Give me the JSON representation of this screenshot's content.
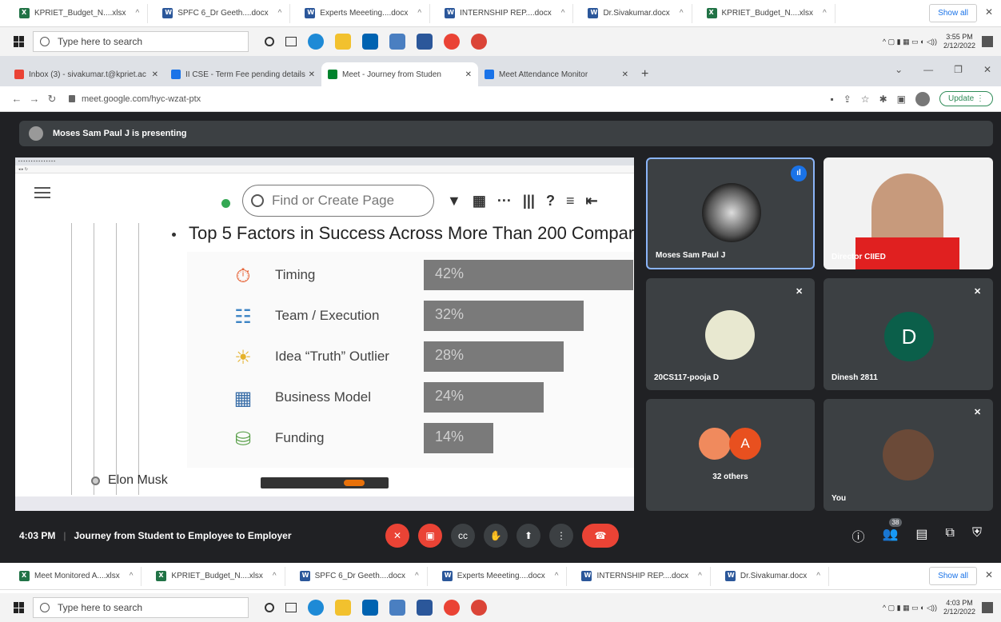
{
  "top_downloads": [
    {
      "name": "KPRIET_Budget_N....xlsx",
      "type": "xls"
    },
    {
      "name": "SPFC 6_Dr Geeth....docx",
      "type": "doc"
    },
    {
      "name": "Experts Meeeting....docx",
      "type": "doc"
    },
    {
      "name": "INTERNSHIP REP....docx",
      "type": "doc"
    },
    {
      "name": "Dr.Sivakumar.docx",
      "type": "doc"
    },
    {
      "name": "KPRIET_Budget_N....xlsx",
      "type": "xls"
    }
  ],
  "show_all": "Show all",
  "close_glyph": "✕",
  "chevron_glyph": "^",
  "top_taskbar": {
    "search_placeholder": "Type here to search",
    "time": "3:55 PM",
    "date": "2/12/2022"
  },
  "browser_tabs": [
    {
      "label": "Inbox (3) - sivakumar.t@kpriet.ac",
      "color": "#ea4335",
      "active": false
    },
    {
      "label": "II CSE - Term Fee pending details",
      "color": "#1a73e8",
      "active": false
    },
    {
      "label": "Meet - Journey from Studen",
      "color": "#00832d",
      "active": true
    },
    {
      "label": "Meet Attendance Monitor",
      "color": "#1a73e8",
      "active": false
    }
  ],
  "new_tab_glyph": "+",
  "url": "meet.google.com/hyc-wzat-ptx",
  "update_label": "Update",
  "presenting_text": "Moses Sam Paul J is presenting",
  "shared_screen": {
    "find_placeholder": "Find or Create Page",
    "slide_title": "Top 5 Factors in Success Across More Than 200 Compar",
    "factors": [
      {
        "label": "Timing",
        "value": "42%",
        "pct": 42,
        "icon": "⏱",
        "icon_color": "#e55a2b"
      },
      {
        "label": "Team / Execution",
        "value": "32%",
        "pct": 32,
        "icon": "☷",
        "icon_color": "#3b83c4"
      },
      {
        "label": "Idea “Truth” Outlier",
        "value": "28%",
        "pct": 28,
        "icon": "☀",
        "icon_color": "#e5b22b"
      },
      {
        "label": "Business Model",
        "value": "24%",
        "pct": 24,
        "icon": "▦",
        "icon_color": "#3b6fa8"
      },
      {
        "label": "Funding",
        "value": "14%",
        "pct": 14,
        "icon": "⛁",
        "icon_color": "#5aa04a"
      }
    ],
    "bullet_item": "Elon Musk"
  },
  "participants": [
    {
      "name": "Moses Sam Paul J",
      "speaking": true
    },
    {
      "name": "Director CIIED",
      "speaking": false
    },
    {
      "name": "20CS117-pooja D",
      "muted": true
    },
    {
      "name": "Dinesh 2811",
      "muted": true,
      "initial": "D",
      "avatar_color": "#0b5f4a"
    },
    {
      "name": "32 others",
      "initial": "A",
      "avatar_color": "#e8501f"
    },
    {
      "name": "You",
      "muted": true
    }
  ],
  "meeting": {
    "time": "4:03 PM",
    "title": "Journey from Student to Employee to Employer",
    "participant_count": "38"
  },
  "bottom_downloads": [
    {
      "name": "Meet Monitored A....xlsx",
      "type": "xls"
    },
    {
      "name": "KPRIET_Budget_N....xlsx",
      "type": "xls"
    },
    {
      "name": "SPFC 6_Dr Geeth....docx",
      "type": "doc"
    },
    {
      "name": "Experts Meeeting....docx",
      "type": "doc"
    },
    {
      "name": "INTERNSHIP REP....docx",
      "type": "doc"
    },
    {
      "name": "Dr.Sivakumar.docx",
      "type": "doc"
    }
  ],
  "bottom_taskbar": {
    "search_placeholder": "Type here to search",
    "time": "4:03 PM",
    "date": "2/12/2022"
  }
}
